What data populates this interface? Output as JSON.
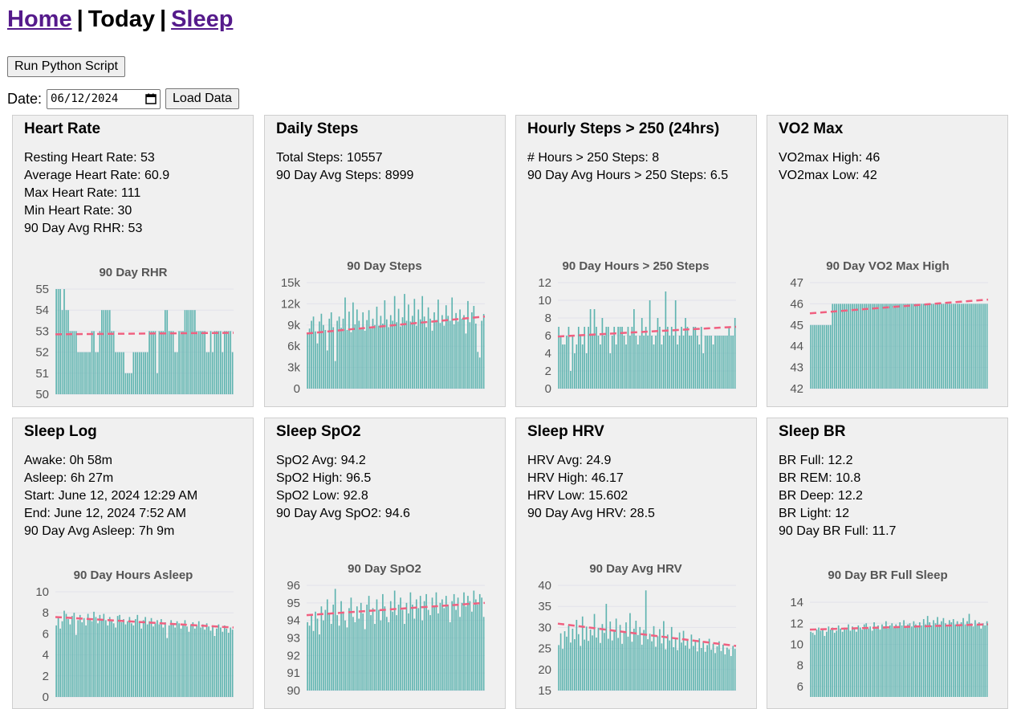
{
  "nav": {
    "home": "Home",
    "sep1": "|",
    "today": "Today",
    "sep2": "|",
    "sleep": "Sleep"
  },
  "controls": {
    "run_button": "Run Python Script",
    "date_label": "Date:",
    "date_value": "06/12/2024",
    "load_button": "Load Data"
  },
  "colors": {
    "bar": "#5fb4b0",
    "trend": "#f06080",
    "card_bg": "#f0f0f0",
    "link": "#551A8B"
  },
  "cards": [
    {
      "title": "Heart Rate",
      "stats": [
        "Resting Heart Rate: 53",
        "Average Heart Rate: 60.9",
        "Max Heart Rate: 111",
        "Min Heart Rate: 30",
        "90 Day Avg RHR: 53"
      ],
      "chart_data": {
        "type": "bar",
        "title": "90 Day RHR",
        "ylim": [
          50,
          55
        ],
        "yticks": [
          50,
          51,
          52,
          53,
          54,
          55
        ],
        "ytick_labels": [
          "50",
          "51",
          "52",
          "53",
          "54",
          "55"
        ],
        "values": [
          55,
          55,
          55,
          54,
          55,
          54,
          54,
          53,
          53,
          53,
          53,
          52,
          52,
          52,
          52,
          52,
          52,
          52,
          53,
          53,
          52,
          52,
          53,
          54,
          54,
          54,
          54,
          54,
          53,
          53,
          52,
          52,
          52,
          52,
          52,
          51,
          51,
          51,
          51,
          52,
          52,
          52,
          52,
          52,
          52,
          52,
          52,
          53,
          53,
          53,
          53,
          51,
          53,
          53,
          53,
          54,
          54,
          53,
          53,
          53,
          52,
          52,
          53,
          53,
          53,
          54,
          54,
          54,
          54,
          54,
          54,
          53,
          53,
          53,
          53,
          53,
          52,
          52,
          53,
          52,
          53,
          53,
          53,
          53,
          52,
          53,
          53,
          53,
          53,
          52
        ],
        "trend": [
          52.85,
          52.92
        ]
      }
    },
    {
      "title": "Daily Steps",
      "stats": [
        "Total Steps: 10557",
        "90 Day Avg Steps: 8999"
      ],
      "chart_data": {
        "type": "bar",
        "title": "90 Day Steps",
        "ylim": [
          0,
          15000
        ],
        "yticks": [
          0,
          3000,
          6000,
          9000,
          12000,
          15000
        ],
        "ytick_labels": [
          "0",
          "3k",
          "6k",
          "9k",
          "12k",
          "15k"
        ],
        "values": [
          7800,
          8500,
          9600,
          10200,
          8100,
          6400,
          9500,
          10600,
          9000,
          8300,
          5400,
          9900,
          10800,
          8700,
          3900,
          9600,
          10200,
          8600,
          9900,
          12900,
          8300,
          10900,
          8000,
          12200,
          9100,
          11200,
          9600,
          8400,
          10800,
          8200,
          9700,
          11100,
          8500,
          9900,
          9000,
          11600,
          8900,
          10300,
          9200,
          12500,
          9800,
          8700,
          10400,
          9600,
          13100,
          9400,
          11300,
          8800,
          10100,
          13400,
          9600,
          11900,
          9500,
          10300,
          12700,
          8900,
          11200,
          9800,
          13100,
          10200,
          8700,
          11500,
          9900,
          8200,
          10800,
          9700,
          12600,
          9300,
          10400,
          8900,
          11800,
          10300,
          9600,
          12900,
          9100,
          10700,
          9500,
          11200,
          9900,
          10400,
          7800,
          12400,
          9400,
          10800,
          11700,
          9200,
          5200,
          4400,
          9600,
          10557
        ],
        "trend": [
          7800,
          10200
        ]
      }
    },
    {
      "title": "Hourly Steps > 250 (24hrs)",
      "stats": [
        "# Hours > 250 Steps: 8",
        "90 Day Avg Hours > 250 Steps: 6.5"
      ],
      "chart_data": {
        "type": "bar",
        "title": "90 Day Hours > 250 Steps",
        "ylim": [
          0,
          12
        ],
        "yticks": [
          0,
          2,
          4,
          6,
          8,
          10,
          12
        ],
        "ytick_labels": [
          "0",
          "2",
          "4",
          "6",
          "8",
          "10",
          "12"
        ],
        "values": [
          7,
          6,
          5,
          5,
          6,
          7,
          2,
          6,
          4,
          5,
          7,
          6,
          5,
          7,
          4,
          7,
          9,
          6,
          9,
          7,
          6,
          5,
          8,
          6,
          7,
          7,
          4,
          6,
          7,
          5,
          7,
          7,
          7,
          6,
          5,
          7,
          6,
          7,
          9,
          6,
          5,
          6,
          8,
          6,
          7,
          6,
          10,
          6,
          5,
          6,
          8,
          7,
          5,
          6,
          11,
          7,
          6,
          7,
          6,
          10,
          5,
          6,
          7,
          6,
          8,
          7,
          6,
          6,
          7,
          7,
          6,
          5,
          7,
          4,
          6,
          6,
          6,
          6,
          5,
          6,
          6,
          6,
          6,
          6,
          6,
          6,
          7,
          6,
          6,
          8
        ],
        "trend": [
          5.9,
          7.0
        ]
      }
    },
    {
      "title": "VO2 Max",
      "stats": [
        "VO2max High: 46",
        "VO2max Low: 42"
      ],
      "chart_data": {
        "type": "bar",
        "title": "90 Day VO2 Max High",
        "ylim": [
          42,
          47
        ],
        "yticks": [
          42,
          43,
          44,
          45,
          46,
          47
        ],
        "ytick_labels": [
          "42",
          "43",
          "44",
          "45",
          "46",
          "47"
        ],
        "values": [
          45,
          45,
          45,
          45,
          45,
          45,
          45,
          45,
          45,
          45,
          45,
          46,
          46,
          46,
          46,
          46,
          46,
          46,
          46,
          46,
          46,
          46,
          46,
          46,
          46,
          46,
          46,
          46,
          46,
          46,
          46,
          46,
          46,
          46,
          46,
          46,
          46,
          46,
          46,
          46,
          46,
          46,
          46,
          46,
          46,
          46,
          46,
          46,
          46,
          46,
          46,
          46,
          46,
          46,
          46,
          46,
          46,
          46,
          46,
          46,
          46,
          46,
          46,
          46,
          46,
          46,
          46,
          46,
          46,
          46,
          46,
          46,
          46,
          46,
          46,
          46,
          46,
          46,
          46,
          46,
          46,
          46,
          46,
          46,
          46,
          46,
          46,
          46,
          46,
          46
        ],
        "trend": [
          45.55,
          46.2
        ]
      }
    },
    {
      "title": "Sleep Log",
      "stats": [
        "Awake: 0h 58m",
        "Asleep: 6h 27m",
        "Start: June 12, 2024 12:29 AM",
        "End: June 12, 2024 7:52 AM",
        "90 Day Avg Asleep: 7h 9m"
      ],
      "chart_data": {
        "type": "bar",
        "title": "90 Day Hours Asleep",
        "ylim": [
          0,
          10
        ],
        "yticks": [
          0,
          2,
          4,
          6,
          8,
          10
        ],
        "ytick_labels": [
          "0",
          "2",
          "4",
          "6",
          "8",
          "10"
        ],
        "values": [
          6.8,
          7.6,
          6.5,
          7.2,
          8.2,
          7.9,
          7.4,
          6.9,
          7.7,
          8.0,
          5.9,
          7.3,
          7.8,
          7.1,
          7.5,
          6.8,
          7.9,
          7.4,
          7.2,
          8.1,
          7.6,
          7.0,
          7.8,
          7.4,
          7.9,
          7.3,
          6.8,
          7.6,
          7.2,
          7.0,
          6.6,
          7.7,
          7.8,
          7.1,
          7.4,
          6.9,
          7.2,
          7.6,
          7.0,
          6.8,
          7.4,
          7.8,
          7.1,
          6.5,
          7.3,
          7.6,
          6.9,
          7.2,
          7.5,
          6.7,
          7.0,
          7.3,
          6.9,
          7.4,
          6.6,
          7.1,
          5.6,
          6.8,
          7.3,
          6.9,
          6.6,
          7.2,
          7.0,
          6.5,
          6.9,
          7.3,
          6.7,
          6.2,
          6.9,
          7.1,
          6.5,
          6.8,
          7.2,
          6.6,
          6.9,
          6.4,
          7.0,
          6.7,
          6.3,
          6.8,
          5.8,
          6.5,
          6.9,
          6.6,
          6.2,
          6.8,
          6.5,
          6.1,
          6.6,
          6.4
        ],
        "trend": [
          7.6,
          6.6
        ]
      }
    },
    {
      "title": "Sleep SpO2",
      "stats": [
        "SpO2 Avg: 94.2",
        "SpO2 High: 96.5",
        "SpO2 Low: 92.8",
        "90 Day Avg SpO2: 94.6"
      ],
      "chart_data": {
        "type": "bar",
        "title": "90 Day SpO2",
        "ylim": [
          90,
          96
        ],
        "yticks": [
          90,
          91,
          92,
          93,
          94,
          95,
          96
        ],
        "ytick_labels": [
          "90",
          "91",
          "92",
          "93",
          "94",
          "95",
          "96"
        ],
        "values": [
          93.9,
          93.7,
          94.3,
          93.4,
          94.5,
          94.1,
          93.2,
          94.8,
          94.0,
          94.6,
          95.2,
          94.4,
          93.8,
          94.9,
          95.8,
          94.3,
          93.7,
          95.1,
          94.5,
          94.0,
          93.6,
          94.7,
          95.3,
          94.2,
          93.9,
          94.8,
          94.1,
          95.0,
          94.4,
          93.5,
          94.9,
          95.4,
          94.3,
          94.7,
          93.8,
          95.2,
          94.6,
          94.0,
          95.5,
          94.8,
          94.2,
          93.9,
          95.1,
          94.5,
          95.7,
          94.3,
          94.9,
          95.3,
          94.6,
          93.8,
          95.0,
          94.4,
          95.6,
          94.9,
          94.1,
          95.2,
          94.7,
          95.4,
          94.0,
          95.1,
          95.5,
          94.6,
          94.3,
          95.3,
          94.8,
          95.6,
          94.4,
          95.0,
          95.2,
          94.7,
          95.4,
          94.9,
          93.9,
          95.1,
          95.5,
          94.6,
          95.3,
          94.2,
          95.0,
          95.6,
          94.8,
          95.4,
          95.1,
          94.5,
          95.7,
          95.2,
          94.9,
          95.5,
          95.3,
          94.2
        ],
        "trend": [
          94.3,
          95.0
        ]
      }
    },
    {
      "title": "Sleep HRV",
      "stats": [
        "HRV Avg: 24.9",
        "HRV High: 46.17",
        "HRV Low: 15.602",
        "90 Day Avg HRV: 28.5"
      ],
      "chart_data": {
        "type": "bar",
        "title": "90 Day Avg HRV",
        "ylim": [
          15,
          40
        ],
        "yticks": [
          15,
          20,
          25,
          30,
          35,
          40
        ],
        "ytick_labels": [
          "15",
          "20",
          "25",
          "30",
          "35",
          "40"
        ],
        "values": [
          25.8,
          28.6,
          24.9,
          29.1,
          27.8,
          30.5,
          26.4,
          29.7,
          27.2,
          31.8,
          28.4,
          25.6,
          32.6,
          27.1,
          30.2,
          26.8,
          29.5,
          28.1,
          33.2,
          27.6,
          29.9,
          26.3,
          30.8,
          28.7,
          35.6,
          27.3,
          31.4,
          26.9,
          29.2,
          32.1,
          27.5,
          30.6,
          26.1,
          28.9,
          31.2,
          27.8,
          33.4,
          26.6,
          29.7,
          31.6,
          28.2,
          30.1,
          25.9,
          29.4,
          38.8,
          27.2,
          28.5,
          26.7,
          30.3,
          25.4,
          27.9,
          29.6,
          26.2,
          31.5,
          24.8,
          28.3,
          26.9,
          30.1,
          25.3,
          27.6,
          24.6,
          28.8,
          26.4,
          29.2,
          25.7,
          27.1,
          24.9,
          28.3,
          25.6,
          26.8,
          24.3,
          27.4,
          25.1,
          26.6,
          24.2,
          25.8,
          27.3,
          24.7,
          26.1,
          23.9,
          25.5,
          26.7,
          24.4,
          25.9,
          23.6,
          25.2,
          24.8,
          23.2,
          25.6,
          24.9
        ],
        "trend": [
          30.9,
          25.6
        ]
      }
    },
    {
      "title": "Sleep BR",
      "stats": [
        "BR Full: 12.2",
        "BR REM: 10.8",
        "BR Deep: 12.2",
        "BR Light: 12",
        "90 Day BR Full: 11.7"
      ],
      "chart_data": {
        "type": "bar",
        "title": "90 Day BR Full Sleep",
        "ylim": [
          5,
          15
        ],
        "yticks": [
          6,
          8,
          10,
          12,
          14
        ],
        "ytick_labels": [
          "6",
          "8",
          "10",
          "12",
          "14"
        ],
        "values": [
          11.2,
          11.1,
          10.9,
          11.4,
          11.6,
          11.3,
          11.5,
          10.8,
          11.2,
          11.7,
          11.4,
          11.6,
          11.1,
          11.3,
          11.8,
          11.5,
          11.2,
          11.6,
          11.4,
          11.9,
          11.3,
          11.7,
          11.5,
          11.2,
          11.8,
          11.6,
          11.4,
          11.9,
          12.0,
          11.5,
          11.7,
          11.3,
          12.1,
          11.6,
          11.8,
          11.4,
          11.9,
          11.7,
          12.2,
          11.5,
          11.8,
          12.0,
          11.6,
          11.9,
          11.7,
          12.1,
          11.8,
          12.3,
          11.6,
          11.9,
          12.0,
          11.7,
          12.2,
          11.9,
          11.6,
          12.1,
          11.8,
          12.4,
          11.9,
          12.7,
          12.1,
          11.8,
          12.3,
          12.0,
          12.6,
          11.9,
          12.2,
          12.5,
          12.0,
          11.7,
          12.3,
          12.1,
          12.4,
          11.9,
          12.2,
          11.8,
          12.1,
          12.5,
          11.9,
          12.2,
          12.9,
          12.0,
          11.7,
          12.3,
          11.9,
          12.1,
          11.5,
          12.0,
          11.8,
          12.2
        ],
        "trend": [
          11.4,
          11.9
        ]
      }
    }
  ]
}
